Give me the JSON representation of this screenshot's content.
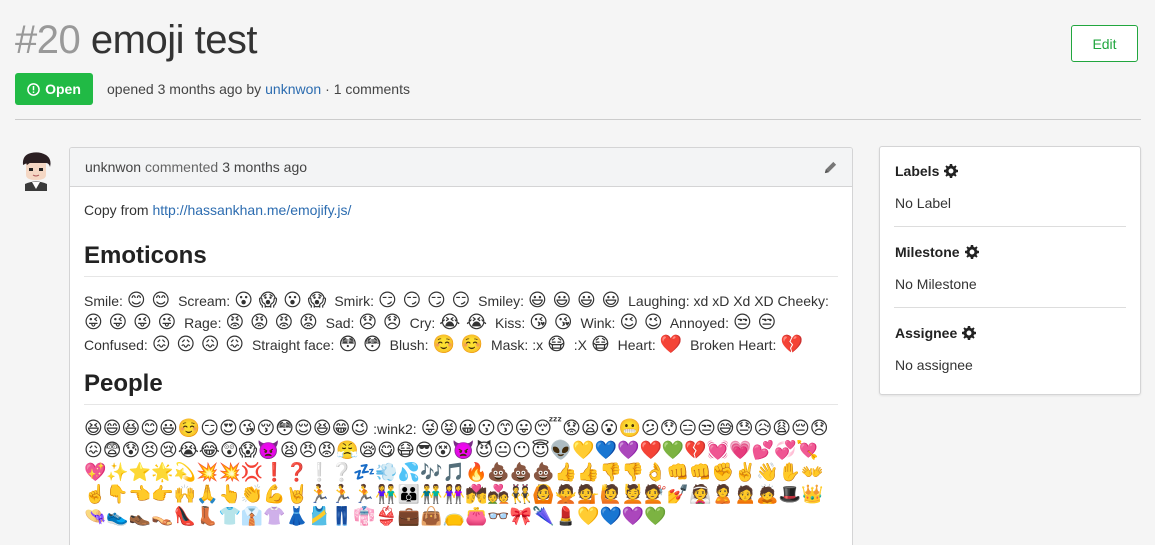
{
  "issue": {
    "number": "#20",
    "title": "emoji test",
    "state_label": "Open",
    "opened_text": "opened 3 months ago by",
    "author": "unknwon",
    "comments_text": "· 1 comments",
    "edit_label": "Edit"
  },
  "comment": {
    "author": "unknwon",
    "action": "commented",
    "time": "3 months ago",
    "copy_prefix": "Copy from",
    "copy_link": "http://hassankhan.me/emojify.js/",
    "emoticons_heading": "Emoticons",
    "people_heading": "People",
    "emoticons": [
      {
        "label": "Smile:",
        "emoji": "😊 😊"
      },
      {
        "label": "Scream:",
        "emoji": "😮 😱 😮 😱"
      },
      {
        "label": "Smirk:",
        "emoji": "😏 😏 😏 😏"
      },
      {
        "label": "Smiley:",
        "emoji": "😃 😃 😃 😃"
      },
      {
        "label": "Laughing: xd xD Xd XD Cheeky:",
        "emoji": "😜 😜 😜 😜"
      },
      {
        "label": "Rage:",
        "emoji": "😡 😡 😡 😡"
      },
      {
        "label": "Sad:",
        "emoji": "😞 😞"
      },
      {
        "label": "Cry:",
        "emoji": "😭 😭"
      },
      {
        "label": "Kiss:",
        "emoji": "😘 😘"
      },
      {
        "label": "Wink:",
        "emoji": "😉 😉"
      },
      {
        "label": "Annoyed:",
        "emoji": "😒 😒"
      },
      {
        "label": "Confused:",
        "emoji": "😖 😖 😖 😖"
      },
      {
        "label": "Straight face:",
        "emoji": "😳 😳"
      },
      {
        "label": "Blush:",
        "emoji": "☺️ ☺️"
      },
      {
        "label": "Mask: :x",
        "emoji": "😷"
      },
      {
        "label": ":X",
        "emoji": "😷"
      },
      {
        "label": "Heart:",
        "emoji": "❤️"
      },
      {
        "label": "Broken Heart:",
        "emoji": "💔"
      }
    ],
    "people_emoji_1": "😆😄😆😊😃☺️😏😍😘😚😳😌😆😁😉",
    "people_wink2": ":wink2:",
    "people_emoji_2": "😜😝😀😗😙😛😴😟😦😮😬😕😯😑😒😅😓😥😩😔😞😖😨😰😣😢😭😂😲😱👿😫😠😡😤😪😋😷😎😵👿😈😐😶😇👽💛💙💜❤️💚💔💓💗💕💞💘💖✨⭐🌟💫💥💥💢❗❓❕❔💤💨💦🎶🎵🔥💩💩💩👍👍👎👎👌👊👊✊✌️👋✋👐☝️👇👈👉🙌🙏👆👏💪🤘🏃🏃🏃👫👪👬👭💏💑👯🙆🙅💁🙋💆💇💅👰🙎🙍🙇🎩👑👒👟👞👡👠👢👕👔👚👗🎽👖👘👙💼👜👝👛👓🎀🌂💄💛💙💜💚"
  },
  "sidebar": {
    "labels_title": "Labels",
    "labels_value": "No Label",
    "milestone_title": "Milestone",
    "milestone_value": "No Milestone",
    "assignee_title": "Assignee",
    "assignee_value": "No assignee"
  },
  "colors": {
    "accent_green": "#21ba45",
    "link_blue": "#2c6cb0"
  }
}
